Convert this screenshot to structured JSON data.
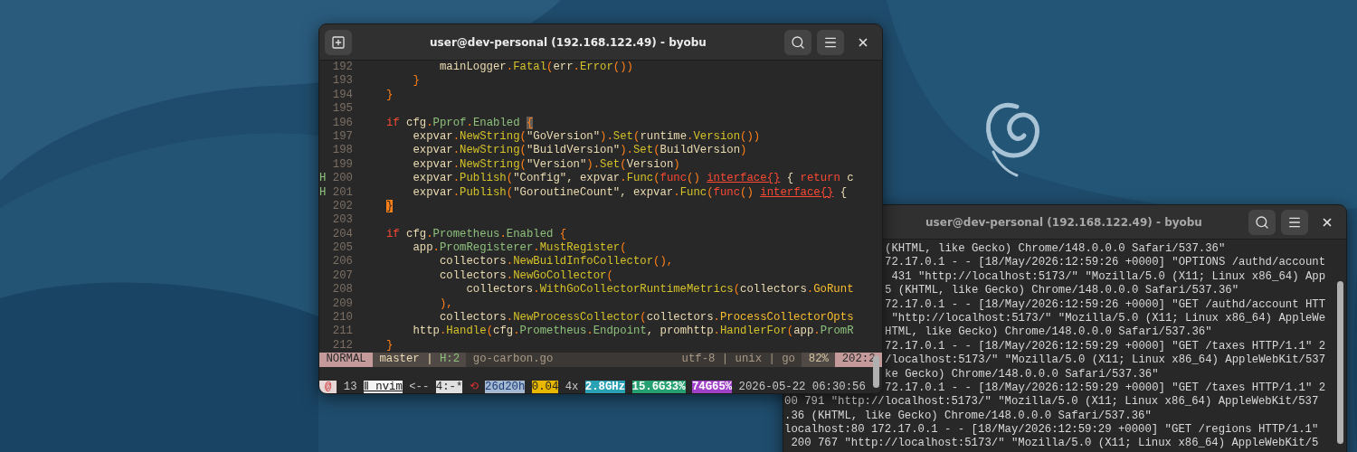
{
  "log_window": {
    "title": "user@dev-personal (192.168.122.49) - byobu",
    "active": false,
    "lines": [
      {
        "kind": "clipped",
        "text": "(KHTML, like Gecko) Chrome/148.0.0.0 Safari/537.36\""
      },
      {
        "kind": "clipped",
        "text": "72.17.0.1 - - [18/May/2026:12:59:26 +0000] \"OPTIONS /authd/account"
      },
      {
        "kind": "clipped",
        "text": " 431 \"http://localhost:5173/\" \"Mozilla/5.0 (X11; Linux x86_64) App"
      },
      {
        "kind": "clipped",
        "text": "5 (KHTML, like Gecko) Chrome/148.0.0.0 Safari/537.36\""
      },
      {
        "kind": "clipped",
        "text": "72.17.0.1 - - [18/May/2026:12:59:26 +0000] \"GET /authd/account HTT"
      },
      {
        "kind": "clipped",
        "text": " \"http://localhost:5173/\" \"Mozilla/5.0 (X11; Linux x86_64) AppleWe"
      },
      {
        "kind": "clipped",
        "text": "HTML, like Gecko) Chrome/148.0.0.0 Safari/537.36\""
      },
      {
        "kind": "clipped",
        "text": "72.17.0.1 - - [18/May/2026:12:59:29 +0000] \"GET /taxes HTTP/1.1\" 2"
      },
      {
        "kind": "clipped",
        "text": "/localhost:5173/\" \"Mozilla/5.0 (X11; Linux x86_64) AppleWebKit/537"
      },
      {
        "kind": "clipped",
        "text": "ke Gecko) Chrome/148.0.0.0 Safari/537.36\""
      },
      {
        "kind": "clipped",
        "text": "72.17.0.1 - - [18/May/2026:12:59:29 +0000] \"GET /taxes HTTP/1.1\" 2"
      },
      {
        "kind": "full",
        "text": "00 791 \"http://localhost:5173/\" \"Mozilla/5.0 (X11; Linux x86_64) AppleWebKit/537"
      },
      {
        "kind": "full",
        "text": ".36 (KHTML, like Gecko) Chrome/148.0.0.0 Safari/537.36\""
      },
      {
        "kind": "full",
        "text": "localhost:80 172.17.0.1 - - [18/May/2026:12:59:29 +0000] \"GET /regions HTTP/1.1\""
      },
      {
        "kind": "full",
        "text": " 200 767 \"http://localhost:5173/\" \"Mozilla/5.0 (X11; Linux x86_64) AppleWebKit/5"
      }
    ]
  },
  "editor_window": {
    "title": "user@dev-personal (192.168.122.49) - byobu",
    "active": true,
    "code_lines": [
      {
        "number": "192",
        "tokens": [
          {
            "kind": "plain",
            "text": "            mainLogger"
          },
          {
            "kind": "punct",
            "text": "."
          },
          {
            "kind": "func",
            "text": "Fatal"
          },
          {
            "kind": "punct",
            "text": "("
          },
          {
            "kind": "plain",
            "text": "err"
          },
          {
            "kind": "punct",
            "text": "."
          },
          {
            "kind": "func",
            "text": "Error"
          },
          {
            "kind": "punct",
            "text": "())"
          }
        ]
      },
      {
        "number": "193",
        "tokens": [
          {
            "kind": "punct",
            "text": "        }"
          }
        ]
      },
      {
        "number": "194",
        "tokens": [
          {
            "kind": "punct",
            "text": "    }"
          }
        ]
      },
      {
        "number": "195"
      },
      {
        "number": "196",
        "tokens": [
          {
            "kind": "keyword",
            "text": "    if"
          },
          {
            "kind": "plain",
            "text": " cfg"
          },
          {
            "kind": "punct",
            "text": "."
          },
          {
            "kind": "field",
            "text": "Pprof"
          },
          {
            "kind": "punct",
            "text": "."
          },
          {
            "kind": "field",
            "text": "Enabled "
          },
          {
            "kind": "match",
            "text": "{"
          }
        ]
      },
      {
        "number": "197",
        "tokens": [
          {
            "kind": "plain",
            "text": "        expvar"
          },
          {
            "kind": "punct",
            "text": "."
          },
          {
            "kind": "func",
            "text": "NewString"
          },
          {
            "kind": "punct",
            "text": "("
          },
          {
            "kind": "string",
            "text": "\"GoVersion\""
          },
          {
            "kind": "punct",
            "text": ")."
          },
          {
            "kind": "func",
            "text": "Set"
          },
          {
            "kind": "punct",
            "text": "("
          },
          {
            "kind": "plain",
            "text": "runtime"
          },
          {
            "kind": "punct",
            "text": "."
          },
          {
            "kind": "func",
            "text": "Version"
          },
          {
            "kind": "punct",
            "text": "())"
          }
        ]
      },
      {
        "number": "198",
        "tokens": [
          {
            "kind": "plain",
            "text": "        expvar"
          },
          {
            "kind": "punct",
            "text": "."
          },
          {
            "kind": "func",
            "text": "NewString"
          },
          {
            "kind": "punct",
            "text": "("
          },
          {
            "kind": "string",
            "text": "\"BuildVersion\""
          },
          {
            "kind": "punct",
            "text": ")."
          },
          {
            "kind": "func",
            "text": "Set"
          },
          {
            "kind": "punct",
            "text": "("
          },
          {
            "kind": "plain",
            "text": "BuildVersion"
          },
          {
            "kind": "punct",
            "text": ")"
          }
        ]
      },
      {
        "number": "199",
        "tokens": [
          {
            "kind": "plain",
            "text": "        expvar"
          },
          {
            "kind": "punct",
            "text": "."
          },
          {
            "kind": "func",
            "text": "NewString"
          },
          {
            "kind": "punct",
            "text": "("
          },
          {
            "kind": "string",
            "text": "\"Version\""
          },
          {
            "kind": "punct",
            "text": ")."
          },
          {
            "kind": "func",
            "text": "Set"
          },
          {
            "kind": "punct",
            "text": "("
          },
          {
            "kind": "plain",
            "text": "Version"
          },
          {
            "kind": "punct",
            "text": ")"
          }
        ]
      },
      {
        "number": "200",
        "sign": "H",
        "tokens": [
          {
            "kind": "plain",
            "text": "        expvar"
          },
          {
            "kind": "punct",
            "text": "."
          },
          {
            "kind": "func",
            "text": "Publish"
          },
          {
            "kind": "punct",
            "text": "("
          },
          {
            "kind": "string",
            "text": "\"Config\""
          },
          {
            "kind": "plain",
            "text": ", expvar"
          },
          {
            "kind": "punct",
            "text": "."
          },
          {
            "kind": "func",
            "text": "Func"
          },
          {
            "kind": "punct",
            "text": "("
          },
          {
            "kind": "keyword",
            "text": "func"
          },
          {
            "kind": "punct",
            "text": "() "
          },
          {
            "kind": "type",
            "text": "interface{}"
          },
          {
            "kind": "plain",
            "text": " { "
          },
          {
            "kind": "keyword",
            "text": "return"
          },
          {
            "kind": "plain",
            "text": " c"
          }
        ]
      },
      {
        "number": "201",
        "sign": "H",
        "tokens": [
          {
            "kind": "plain",
            "text": "        expvar"
          },
          {
            "kind": "punct",
            "text": "."
          },
          {
            "kind": "func",
            "text": "Publish"
          },
          {
            "kind": "punct",
            "text": "("
          },
          {
            "kind": "string",
            "text": "\"GoroutineCount\""
          },
          {
            "kind": "plain",
            "text": ", expvar"
          },
          {
            "kind": "punct",
            "text": "."
          },
          {
            "kind": "func",
            "text": "Func"
          },
          {
            "kind": "punct",
            "text": "("
          },
          {
            "kind": "keyword",
            "text": "func"
          },
          {
            "kind": "punct",
            "text": "() "
          },
          {
            "kind": "type",
            "text": "interface{}"
          },
          {
            "kind": "plain",
            "text": " {"
          }
        ]
      },
      {
        "number": "202",
        "tokens": [
          {
            "kind": "cursor",
            "text": "    }"
          }
        ]
      },
      {
        "number": "203"
      },
      {
        "number": "204",
        "tokens": [
          {
            "kind": "keyword",
            "text": "    if"
          },
          {
            "kind": "plain",
            "text": " cfg"
          },
          {
            "kind": "punct",
            "text": "."
          },
          {
            "kind": "field",
            "text": "Prometheus"
          },
          {
            "kind": "punct",
            "text": "."
          },
          {
            "kind": "field",
            "text": "Enabled"
          },
          {
            "kind": "punct",
            "text": " {"
          }
        ]
      },
      {
        "number": "205",
        "tokens": [
          {
            "kind": "plain",
            "text": "        app"
          },
          {
            "kind": "punct",
            "text": "."
          },
          {
            "kind": "field",
            "text": "PromRegisterer"
          },
          {
            "kind": "punct",
            "text": "."
          },
          {
            "kind": "func",
            "text": "MustRegister"
          },
          {
            "kind": "punct",
            "text": "("
          }
        ]
      },
      {
        "number": "206",
        "tokens": [
          {
            "kind": "plain",
            "text": "            collectors"
          },
          {
            "kind": "punct",
            "text": "."
          },
          {
            "kind": "func",
            "text": "NewBuildInfoCollector"
          },
          {
            "kind": "punct",
            "text": "(),"
          }
        ]
      },
      {
        "number": "207",
        "tokens": [
          {
            "kind": "plain",
            "text": "            collectors"
          },
          {
            "kind": "punct",
            "text": "."
          },
          {
            "kind": "func",
            "text": "NewGoCollector"
          },
          {
            "kind": "punct",
            "text": "("
          }
        ]
      },
      {
        "number": "208",
        "tokens": [
          {
            "kind": "plain",
            "text": "                collectors"
          },
          {
            "kind": "punct",
            "text": "."
          },
          {
            "kind": "func",
            "text": "WithGoCollectorRuntimeMetrics"
          },
          {
            "kind": "punct",
            "text": "("
          },
          {
            "kind": "plain",
            "text": "collectors"
          },
          {
            "kind": "punct",
            "text": "."
          },
          {
            "kind": "const",
            "text": "GoRunt"
          }
        ]
      },
      {
        "number": "209",
        "tokens": [
          {
            "kind": "punct",
            "text": "            ),"
          }
        ]
      },
      {
        "number": "210",
        "tokens": [
          {
            "kind": "plain",
            "text": "            collectors"
          },
          {
            "kind": "punct",
            "text": "."
          },
          {
            "kind": "func",
            "text": "NewProcessCollector"
          },
          {
            "kind": "punct",
            "text": "("
          },
          {
            "kind": "plain",
            "text": "collectors"
          },
          {
            "kind": "punct",
            "text": "."
          },
          {
            "kind": "const",
            "text": "ProcessCollectorOpts"
          }
        ]
      },
      {
        "number": "211",
        "tokens": [
          {
            "kind": "plain",
            "text": "        http"
          },
          {
            "kind": "punct",
            "text": "."
          },
          {
            "kind": "func",
            "text": "Handle"
          },
          {
            "kind": "punct",
            "text": "("
          },
          {
            "kind": "plain",
            "text": "cfg"
          },
          {
            "kind": "punct",
            "text": "."
          },
          {
            "kind": "field",
            "text": "Prometheus"
          },
          {
            "kind": "punct",
            "text": "."
          },
          {
            "kind": "field",
            "text": "Endpoint"
          },
          {
            "kind": "plain",
            "text": ", promhttp"
          },
          {
            "kind": "punct",
            "text": "."
          },
          {
            "kind": "func",
            "text": "HandlerFor"
          },
          {
            "kind": "punct",
            "text": "("
          },
          {
            "kind": "plain",
            "text": "app"
          },
          {
            "kind": "punct",
            "text": "."
          },
          {
            "kind": "field",
            "text": "PromR"
          }
        ]
      },
      {
        "number": "212",
        "tokens": [
          {
            "kind": "punct",
            "text": "    }"
          }
        ]
      }
    ],
    "status_line": {
      "mode": "NORMAL",
      "branch": "master",
      "separator": "|",
      "hunks": "H:2",
      "file": "go-carbon.go",
      "file_info": "utf-8 | unix | go",
      "percent": "82%",
      "position": "202:2"
    },
    "byobu_bar": [
      {
        "kind": "session",
        "text": "@"
      },
      {
        "kind": "plain",
        "text": "13"
      },
      {
        "kind": "active-window",
        "text": "Ⅱ nvim"
      },
      {
        "kind": "plain",
        "text": "<--"
      },
      {
        "kind": "window",
        "text": "4:-*"
      },
      {
        "kind": "alert",
        "text": "⟲"
      },
      {
        "kind": "uptime",
        "text": "26d20h"
      },
      {
        "kind": "load",
        "text": "0.04"
      },
      {
        "kind": "plain",
        "text": "4x"
      },
      {
        "kind": "cpu",
        "text": "2.8GHz"
      },
      {
        "kind": "memory",
        "text": "15.6G33%"
      },
      {
        "kind": "disk",
        "text": "74G65%"
      },
      {
        "kind": "plain",
        "text": "2026-05-22 06:30:56"
      }
    ]
  }
}
